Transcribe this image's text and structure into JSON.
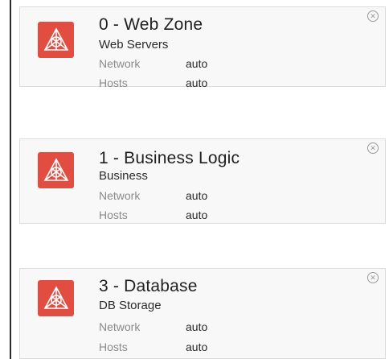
{
  "colors": {
    "icon_bg": "#e24d42",
    "card_bg": "#f8f8f8",
    "card_border": "#dcdcdc",
    "label": "#8a8a8a",
    "value": "#2a2a2a"
  },
  "tiers": [
    {
      "title": "0 - Web Zone",
      "subtitle": "Web Servers",
      "icon": "network-tier-icon",
      "network_label": "Network",
      "network_value": "auto",
      "hosts_label": "Hosts",
      "hosts_value": "auto",
      "close_glyph": "✕"
    },
    {
      "title": "1 - Business Logic",
      "subtitle": "Business",
      "icon": "network-tier-icon",
      "network_label": "Network",
      "network_value": "auto",
      "hosts_label": "Hosts",
      "hosts_value": "auto",
      "close_glyph": "✕"
    },
    {
      "title": "3 - Database",
      "subtitle": "DB Storage",
      "icon": "network-tier-icon",
      "network_label": "Network",
      "network_value": "auto",
      "hosts_label": "Hosts",
      "hosts_value": "auto",
      "close_glyph": "✕"
    }
  ]
}
